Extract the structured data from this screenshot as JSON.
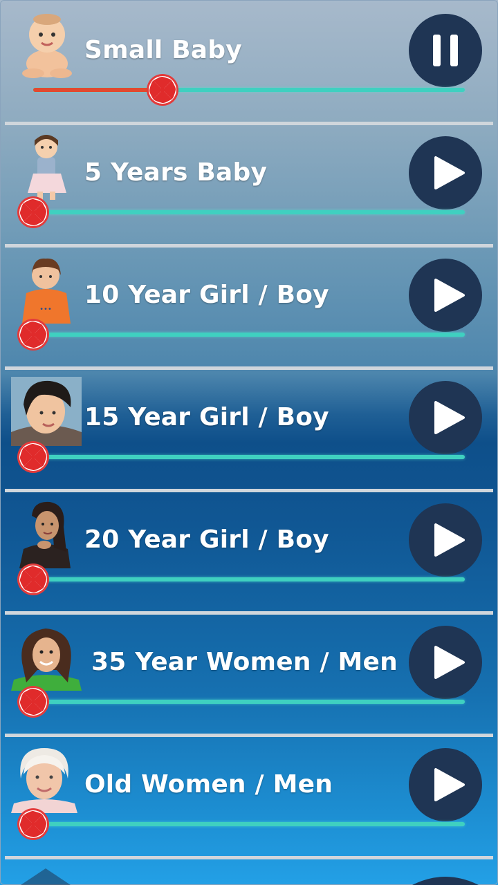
{
  "colors": {
    "button_bg": "#1f3554",
    "track": "#3fd0c0",
    "track_progress": "#e2492f",
    "divider": "#d0d6dc",
    "title_text": "#ffffff"
  },
  "items": [
    {
      "title": "Small Baby",
      "state": "playing",
      "control_icon": "pause-icon",
      "progress": 0.3
    },
    {
      "title": "5 Years Baby",
      "state": "stopped",
      "control_icon": "play-icon",
      "progress": 0
    },
    {
      "title": "10 Year Girl / Boy",
      "state": "stopped",
      "control_icon": "play-icon",
      "progress": 0
    },
    {
      "title": "15 Year Girl / Boy",
      "state": "stopped",
      "control_icon": "play-icon",
      "progress": 0
    },
    {
      "title": "20 Year Girl / Boy",
      "state": "stopped",
      "control_icon": "play-icon",
      "progress": 0
    },
    {
      "title": "35 Year Women / Men",
      "state": "stopped",
      "control_icon": "play-icon",
      "progress": 0
    },
    {
      "title": "Old Women / Men",
      "state": "stopped",
      "control_icon": "play-icon",
      "progress": 0
    }
  ]
}
